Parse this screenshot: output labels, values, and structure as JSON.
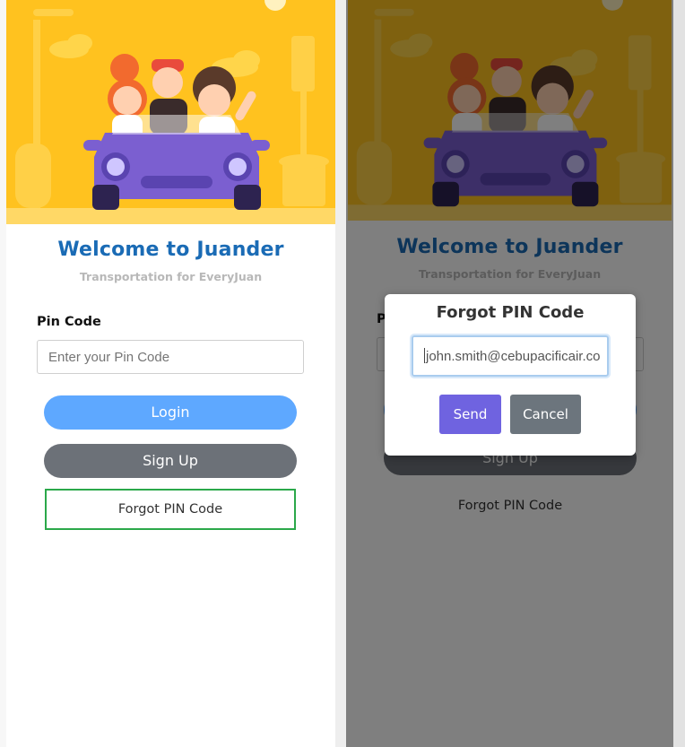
{
  "app": {
    "title": "Welcome to Juander",
    "subtitle": "Transportation for EveryJuan"
  },
  "login_form": {
    "pin_label": "Pin Code",
    "pin_placeholder": "Enter your Pin Code",
    "login_label": "Login",
    "signup_label": "Sign Up",
    "forgot_label": "Forgot PIN Code"
  },
  "forgot_modal": {
    "title": "Forgot PIN Code",
    "email_value": "john.smith@cebupacificair.co",
    "send_label": "Send",
    "cancel_label": "Cancel"
  },
  "colors": {
    "brand_blue": "#1a6bb5",
    "login_button": "#5ea8ff",
    "signup_button": "#6c7178",
    "send_button": "#6f63e0",
    "cancel_button": "#6c757d",
    "focus_outline": "#2ba84a",
    "hero_background": "#ffc21f",
    "car_purple": "#7b5fd0"
  },
  "icons": [
    "hero-illustration",
    "car-icon",
    "traffic-light-icon",
    "street-lamp-icon"
  ]
}
